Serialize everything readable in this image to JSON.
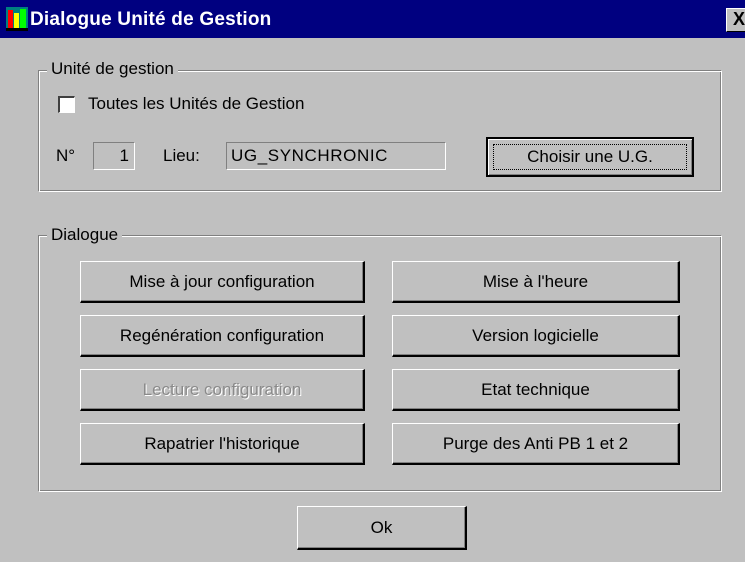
{
  "window": {
    "title": "Dialogue Unité de Gestion",
    "close_glyph": "X",
    "icon": "app-icon"
  },
  "unit_group": {
    "legend": "Unité de gestion",
    "all_units_label": "Toutes les Unités de Gestion",
    "all_units_checked": false,
    "number_label": "N°",
    "number_value": "1",
    "place_label": "Lieu:",
    "place_value": "UG_SYNCHRONIC",
    "choose_button": "Choisir une U.G."
  },
  "dialogue_group": {
    "legend": "Dialogue",
    "buttons": [
      {
        "label": "Mise à jour configuration",
        "enabled": true
      },
      {
        "label": "Mise à l'heure",
        "enabled": true
      },
      {
        "label": "Regénération configuration",
        "enabled": true
      },
      {
        "label": "Version logicielle",
        "enabled": true
      },
      {
        "label": "Lecture configuration",
        "enabled": false
      },
      {
        "label": "Etat technique",
        "enabled": true
      },
      {
        "label": "Rapatrier l'historique",
        "enabled": true
      },
      {
        "label": "Purge des Anti PB 1 et 2",
        "enabled": true
      }
    ]
  },
  "ok_button": "Ok",
  "colors": {
    "title_bar": "#000080",
    "face": "#c0c0c0",
    "disabled_text": "#8a8a8a"
  }
}
